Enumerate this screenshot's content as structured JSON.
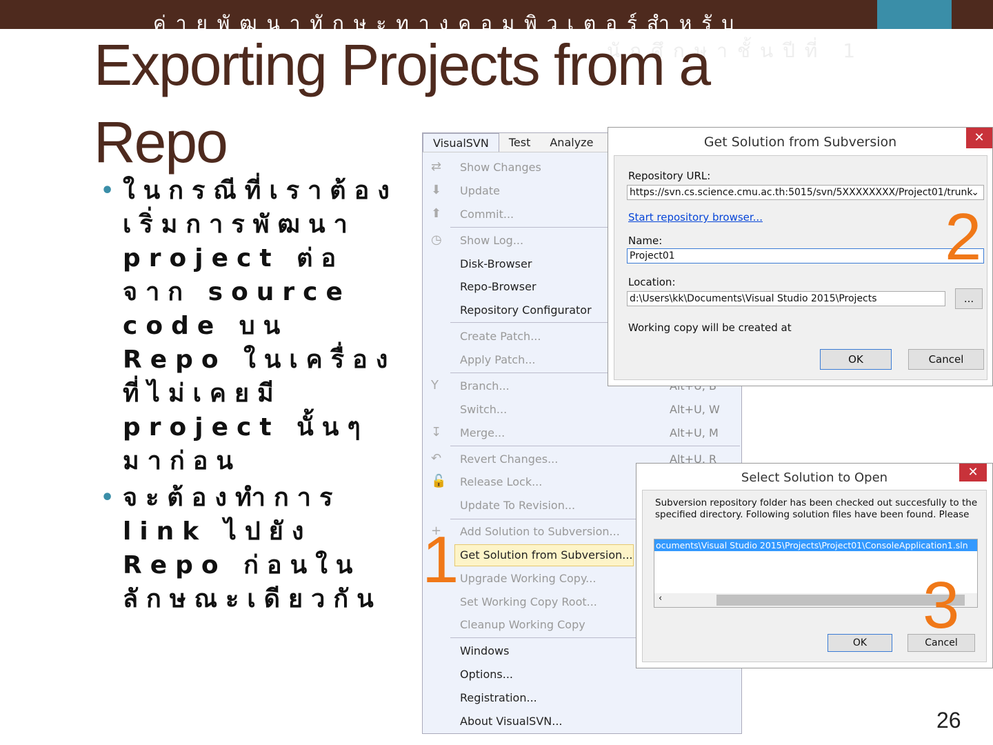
{
  "slide": {
    "header": "ค่ายพัฒนาทักษะทางคอมพิวเตอร์สำหรับ",
    "header2": "นักศึกษาชั้นปีที่ 1",
    "title": "Exporting Projects from a Repo",
    "bullets": [
      "ในกรณีที่เราต้องเริ่มการพัฒนา project ต่อจาก source code บน Repo ในเครื่องที่ไม่เคยมี project นั้นๆ มาก่อน",
      "จะต้องทำการ link ไปยัง Repo ก่อนในลักษณะเดียวกัน"
    ],
    "page_number": "26",
    "accent": "#4e2a1e",
    "teal": "#3a8ea8"
  },
  "menu": {
    "bar": [
      "VisualSVN",
      "Test",
      "Analyze"
    ],
    "items": [
      {
        "label": "Show Changes",
        "enabled": false,
        "icon": "show-changes-icon"
      },
      {
        "label": "Update",
        "enabled": false,
        "icon": "update-icon"
      },
      {
        "label": "Commit...",
        "enabled": false,
        "icon": "commit-icon"
      },
      {
        "label": "Show Log...",
        "enabled": false,
        "icon": "clock-icon"
      },
      {
        "label": "Disk-Browser",
        "enabled": true
      },
      {
        "label": "Repo-Browser",
        "enabled": true
      },
      {
        "label": "Repository Configurator",
        "enabled": true
      },
      {
        "label": "Create Patch...",
        "enabled": false
      },
      {
        "label": "Apply Patch...",
        "enabled": false
      },
      {
        "label": "Branch...",
        "enabled": false,
        "shortcut": "Alt+U, B",
        "icon": "branch-icon"
      },
      {
        "label": "Switch...",
        "enabled": false,
        "shortcut": "Alt+U, W"
      },
      {
        "label": "Merge...",
        "enabled": false,
        "shortcut": "Alt+U, M",
        "icon": "merge-icon"
      },
      {
        "label": "Revert Changes...",
        "enabled": false,
        "shortcut": "Alt+U, R",
        "icon": "revert-icon"
      },
      {
        "label": "Release Lock...",
        "enabled": false,
        "icon": "lock-icon"
      },
      {
        "label": "Update To Revision...",
        "enabled": false
      },
      {
        "label": "Add Solution to Subversion...",
        "enabled": false,
        "icon": "add-icon"
      },
      {
        "label": "Get Solution from Subversion...",
        "enabled": true
      },
      {
        "label": "Upgrade Working Copy...",
        "enabled": false
      },
      {
        "label": "Set Working Copy Root...",
        "enabled": false
      },
      {
        "label": "Cleanup Working Copy",
        "enabled": false
      },
      {
        "label": "Windows",
        "enabled": true
      },
      {
        "label": "Options...",
        "enabled": true
      },
      {
        "label": "Registration...",
        "enabled": true
      },
      {
        "label": "About VisualSVN...",
        "enabled": true
      }
    ]
  },
  "dialog1": {
    "title": "Get Solution from Subversion",
    "url_label": "Repository URL:",
    "url": "https://svn.cs.science.cmu.ac.th:5015/svn/5XXXXXXXX/Project01/trunk",
    "browser_link": "Start repository browser...",
    "name_label": "Name:",
    "name": "Project01",
    "location_label": "Location:",
    "location": "d:\\Users\\kk\\Documents\\Visual Studio 2015\\Projects",
    "browse": "...",
    "working_copy": "Working copy will be created at",
    "ok": "OK",
    "cancel": "Cancel",
    "close": "✕"
  },
  "dialog2": {
    "title": "Select Solution to Open",
    "message": "Subversion repository folder has been checked out succesfully to the specified directory. Following solution files have been found. Please",
    "file": "ocuments\\Visual Studio 2015\\Projects\\Project01\\ConsoleApplication1.sln",
    "ok": "OK",
    "cancel": "Cancel",
    "close": "✕"
  },
  "steps": [
    "1",
    "2",
    "3"
  ]
}
